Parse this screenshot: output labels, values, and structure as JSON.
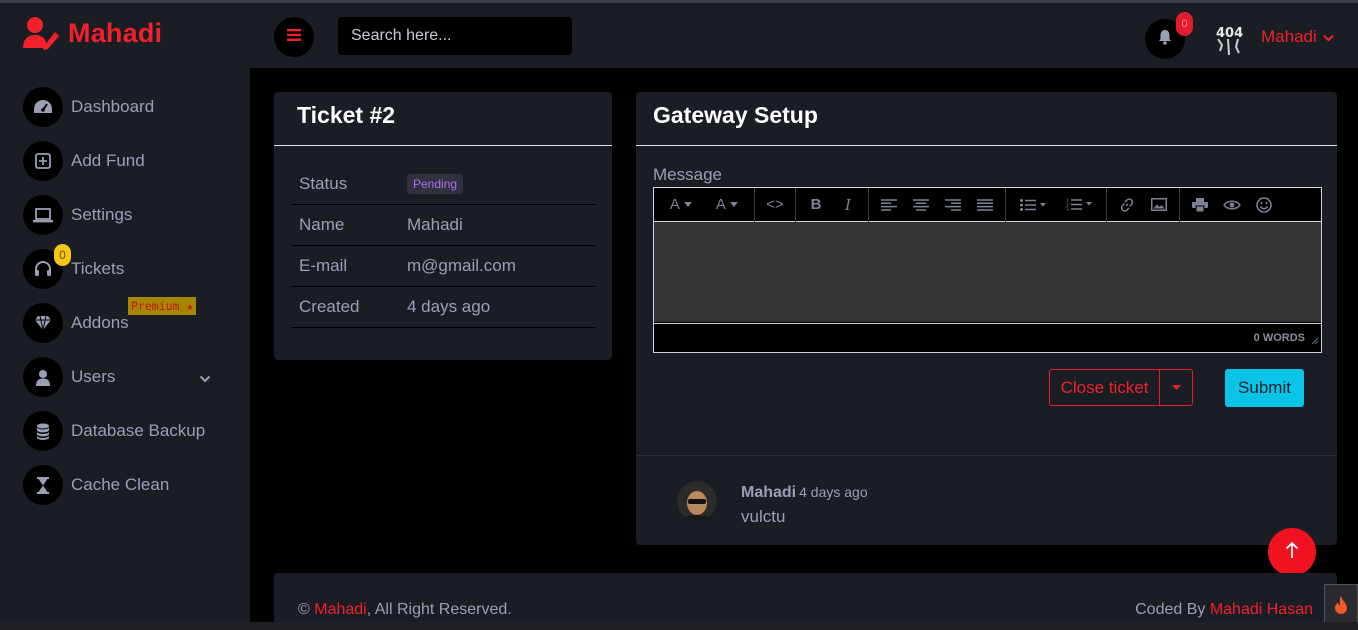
{
  "brand": {
    "name": "Mahadi",
    "logo_icon": "user-edit-icon"
  },
  "header": {
    "search_placeholder": "Search here...",
    "notification_count": "0",
    "user_name": "Mahadi"
  },
  "sidebar": {
    "items": [
      {
        "label": "Dashboard",
        "icon": "dashboard-icon"
      },
      {
        "label": "Add Fund",
        "icon": "plus-square-icon"
      },
      {
        "label": "Settings",
        "icon": "laptop-icon"
      },
      {
        "label": "Tickets",
        "icon": "headset-icon",
        "badge": "0"
      },
      {
        "label": "Addons",
        "icon": "gem-icon",
        "badge": "Premium ★"
      },
      {
        "label": "Users",
        "icon": "user-icon"
      },
      {
        "label": "Database Backup",
        "icon": "database-icon"
      },
      {
        "label": "Cache Clean",
        "icon": "hourglass-icon"
      }
    ]
  },
  "ticket": {
    "title": "Ticket #2",
    "rows": [
      {
        "key": "Status",
        "value": "Pending"
      },
      {
        "key": "Name",
        "value": "Mahadi"
      },
      {
        "key": "E-mail",
        "value": "m@gmail.com"
      },
      {
        "key": "Created",
        "value": "4 days ago"
      }
    ]
  },
  "gateway": {
    "title": "Gateway Setup",
    "message_label": "Message",
    "word_count": "0 WORDS",
    "close_label": "Close ticket",
    "submit_label": "Submit"
  },
  "reply": {
    "author": "Mahadi",
    "time": "4 days ago",
    "text": "vulctu"
  },
  "footer": {
    "copyright_symbol": "©",
    "brand": "Mahadi",
    "rights": ", All Right Reserved.",
    "coded_by": "Coded By",
    "author": "Mahadi Hasan"
  },
  "colors": {
    "accent": "#f0212b",
    "panel": "#1b1d25",
    "submit": "#0ac4e8"
  }
}
